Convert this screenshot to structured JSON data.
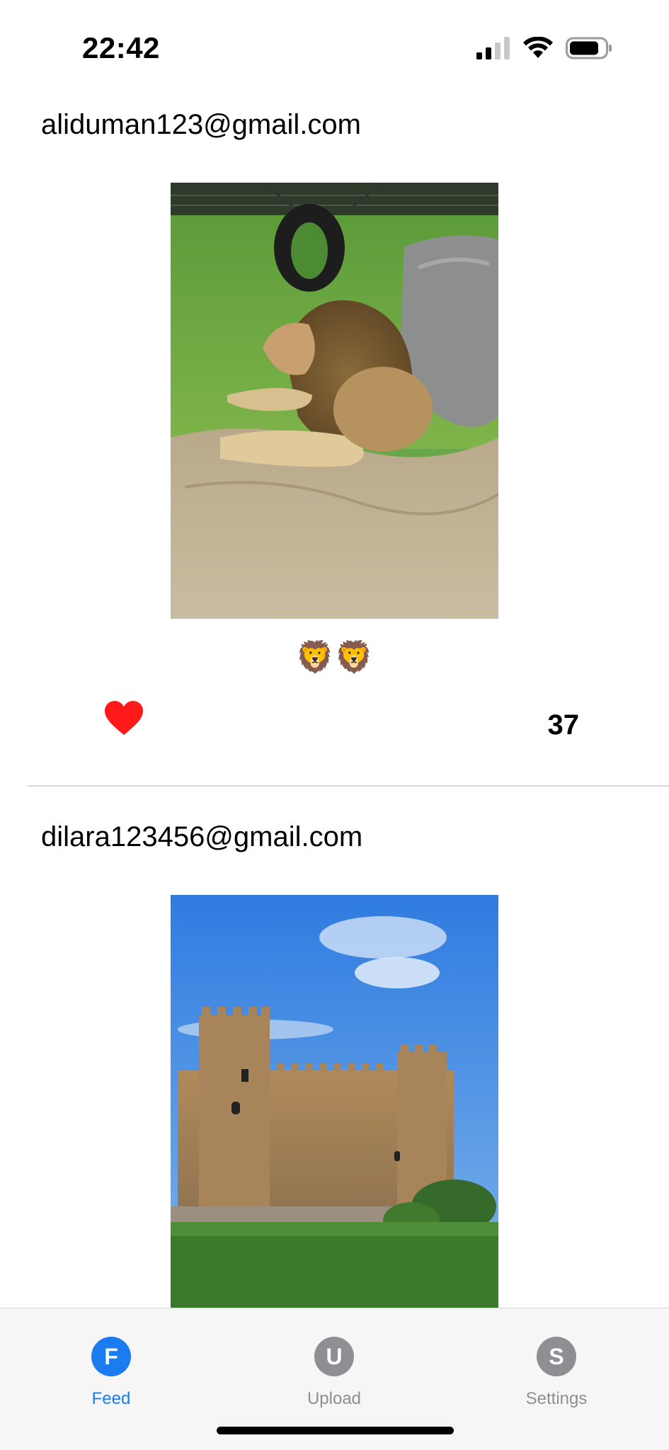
{
  "status_bar": {
    "time": "22:42"
  },
  "posts": [
    {
      "user": "aliduman123@gmail.com",
      "caption": "🦁🦁",
      "likes": "37",
      "image_icon": "lion-photo"
    },
    {
      "user": "dilara123456@gmail.com",
      "image_icon": "castle-photo"
    }
  ],
  "tabs": [
    {
      "letter": "F",
      "label": "Feed",
      "active": true
    },
    {
      "letter": "U",
      "label": "Upload",
      "active": false
    },
    {
      "letter": "S",
      "label": "Settings",
      "active": false
    }
  ],
  "colors": {
    "accent": "#1a7cf0",
    "inactive": "#8e8e93",
    "heart": "#ff1a1a"
  }
}
